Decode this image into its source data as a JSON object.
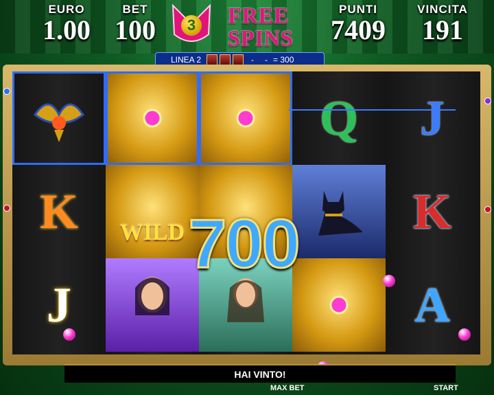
{
  "hud": {
    "euro_label": "EURO",
    "euro_value": "1.00",
    "bet_label": "BET",
    "bet_value": "100",
    "punti_label": "PUNTI",
    "punti_value": "7409",
    "vincita_label": "VINCITA",
    "vincita_value": "191"
  },
  "free_spins": {
    "count": "3",
    "line1": "FREE",
    "line2": "SPINS"
  },
  "line_info": {
    "label": "LINEA 2",
    "dash1": "-",
    "dash2": "-",
    "amount": "= 300"
  },
  "reels": {
    "col1": {
      "r2": "K",
      "r3": "J"
    },
    "col4": {
      "r1": "Q"
    },
    "col5": {
      "r1": "J",
      "r2": "K",
      "r3": "A"
    },
    "wild_label": "WILD"
  },
  "win_amount": "700",
  "message": "HAI VINTO!",
  "buttons": {
    "max_bet": "MAX BET",
    "start": "START"
  },
  "colors": {
    "win": "#3fa9ff",
    "frame": "#d8b86a",
    "highlight": "#2f6cff"
  }
}
